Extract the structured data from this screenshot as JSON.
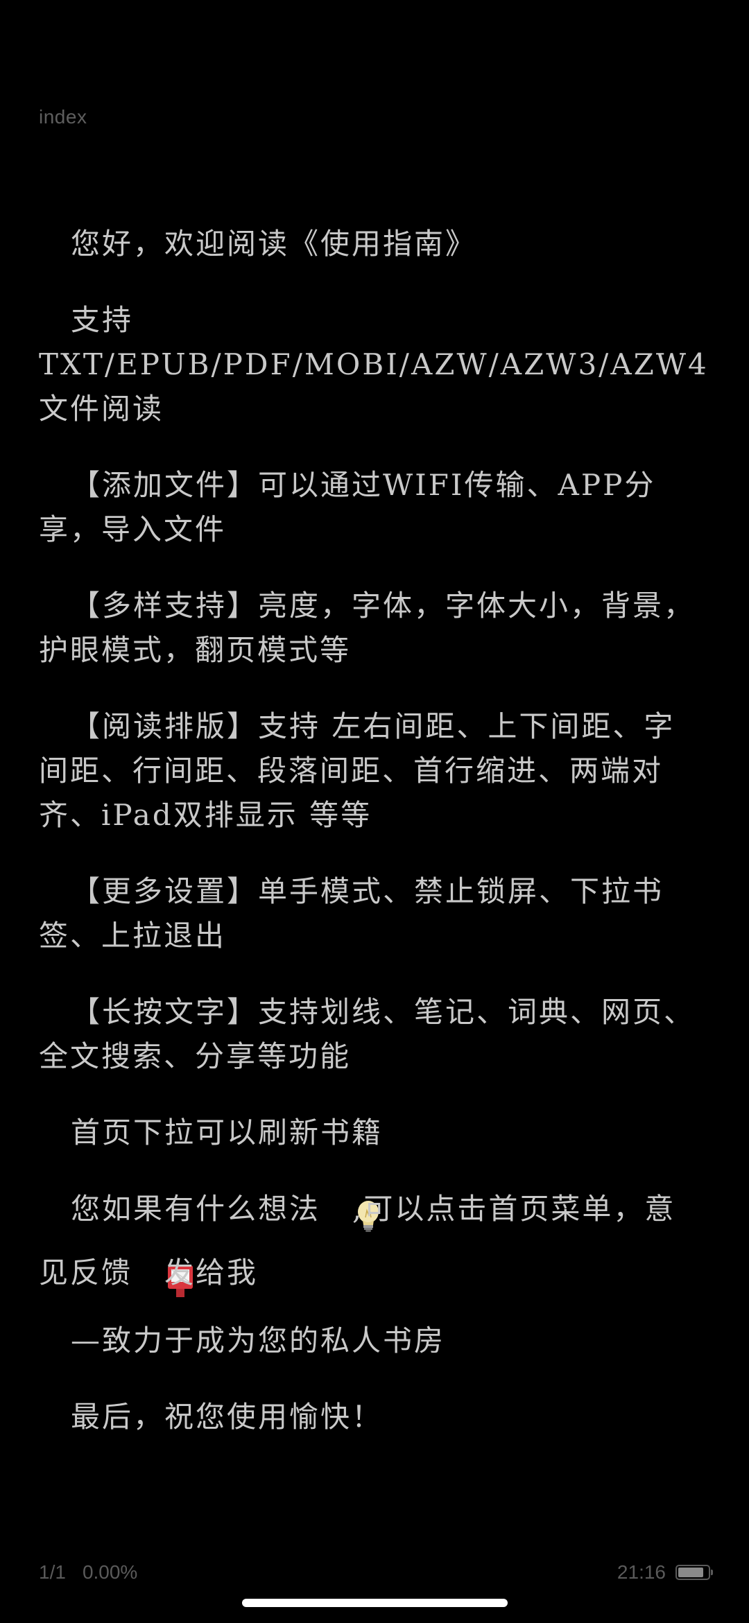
{
  "header": {
    "chapter_title": "index"
  },
  "content": {
    "paragraphs": [
      "您好，欢迎阅读《使用指南》",
      "支持 TXT/EPUB/PDF/MOBI/AZW/AZW3/AZW4 文件阅读",
      "【添加文件】可以通过WIFI传输、APP分享，导入文件",
      "【多样支持】亮度，字体，字体大小，背景，护眼模式，翻页模式等",
      "【阅读排版】支持 左右间距、上下间距、字间距、行间距、段落间距、首行缩进、两端对齐、iPad双排显示 等等",
      "【更多设置】单手模式、禁止锁屏、下拉书签、上拉退出",
      "【长按文字】支持划线、笔记、词典、网页、全文搜索、分享等功能",
      "首页下拉可以刷新书籍"
    ],
    "feedback": {
      "part1": "您如果有什么想法",
      "part2": ",可以点击首页菜单，意见反馈",
      "part3": "发给我",
      "emoji_1": "lightbulb-icon",
      "emoji_2": "postbox-icon"
    },
    "tagline": "—致力于成为您的私人书房",
    "closing": "最后，祝您使用愉快！"
  },
  "footer": {
    "page_indicator": "1/1",
    "progress": "0.00%",
    "time": "21:16",
    "battery_level": 0.85
  },
  "colors": {
    "background": "#000000",
    "text": "#c9c9c9",
    "muted": "#5a5a5a",
    "postbox_red": "#d9363e",
    "bulb_yellow": "#f3e6b0"
  }
}
